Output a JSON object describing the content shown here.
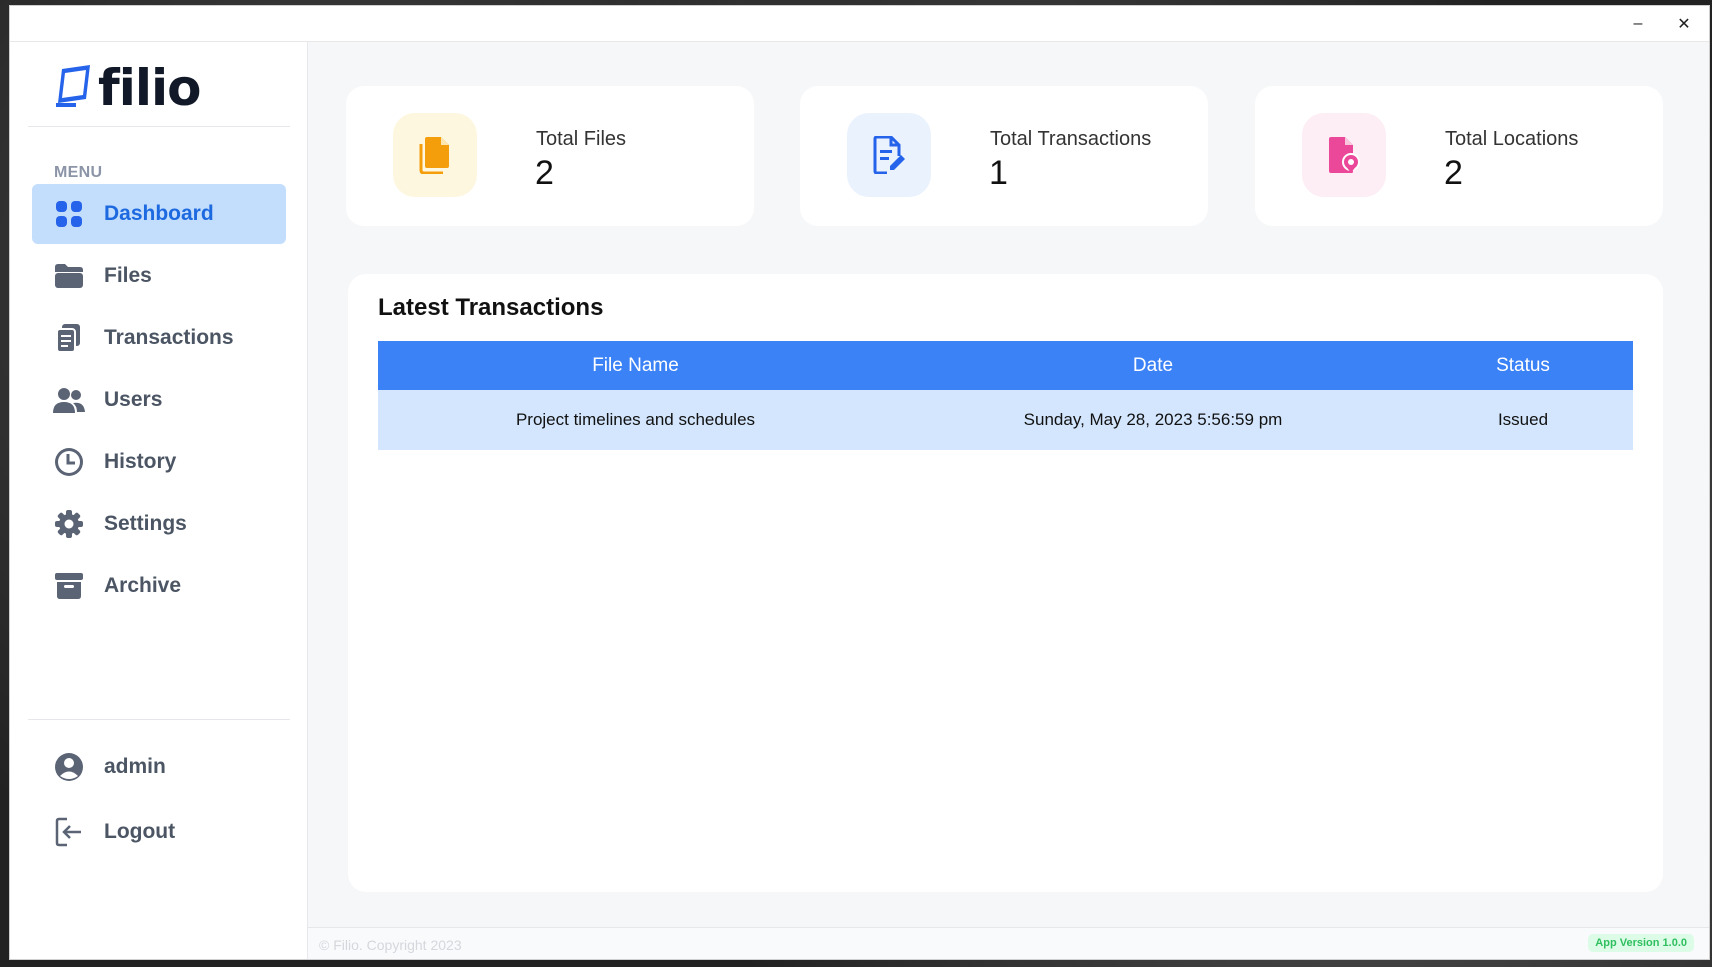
{
  "app": {
    "name": "filio"
  },
  "window_controls": {
    "minimize": "–",
    "close": "✕"
  },
  "sidebar": {
    "menu_label": "MENU",
    "items": [
      {
        "label": "Dashboard",
        "icon": "grid-icon",
        "active": true
      },
      {
        "label": "Files",
        "icon": "folder-icon"
      },
      {
        "label": "Transactions",
        "icon": "clipboard-icon"
      },
      {
        "label": "Users",
        "icon": "users-icon"
      },
      {
        "label": "History",
        "icon": "clock-icon"
      },
      {
        "label": "Settings",
        "icon": "gear-icon"
      },
      {
        "label": "Archive",
        "icon": "archive-icon"
      }
    ],
    "user": {
      "label": "admin",
      "icon": "user-circle-icon"
    },
    "logout": {
      "label": "Logout",
      "icon": "logout-icon"
    }
  },
  "stats": [
    {
      "title": "Total Files",
      "value": "2",
      "icon": "files-icon",
      "color": "#f59e0b",
      "bg": "#fef7e0"
    },
    {
      "title": "Total Transactions",
      "value": "1",
      "icon": "file-edit-icon",
      "color": "#2563eb",
      "bg": "#eaf2fe"
    },
    {
      "title": "Total Locations",
      "value": "2",
      "icon": "file-location-icon",
      "color": "#ec4899",
      "bg": "#fdeef5"
    }
  ],
  "latest_transactions": {
    "title": "Latest Transactions",
    "columns": [
      "File Name",
      "Date",
      "Status"
    ],
    "rows": [
      [
        "Project timelines and schedules",
        "Sunday, May 28, 2023 5:56:59 pm",
        "Issued"
      ]
    ]
  },
  "footer": {
    "copyright": "© Filio. Copyright 2023",
    "version": "App Version 1.0.0"
  },
  "colors": {
    "accent": "#3b82f6",
    "active_nav_bg": "#c3ddfd",
    "active_nav_text": "#1d6ae0",
    "row_bg": "#d3e6fd"
  }
}
